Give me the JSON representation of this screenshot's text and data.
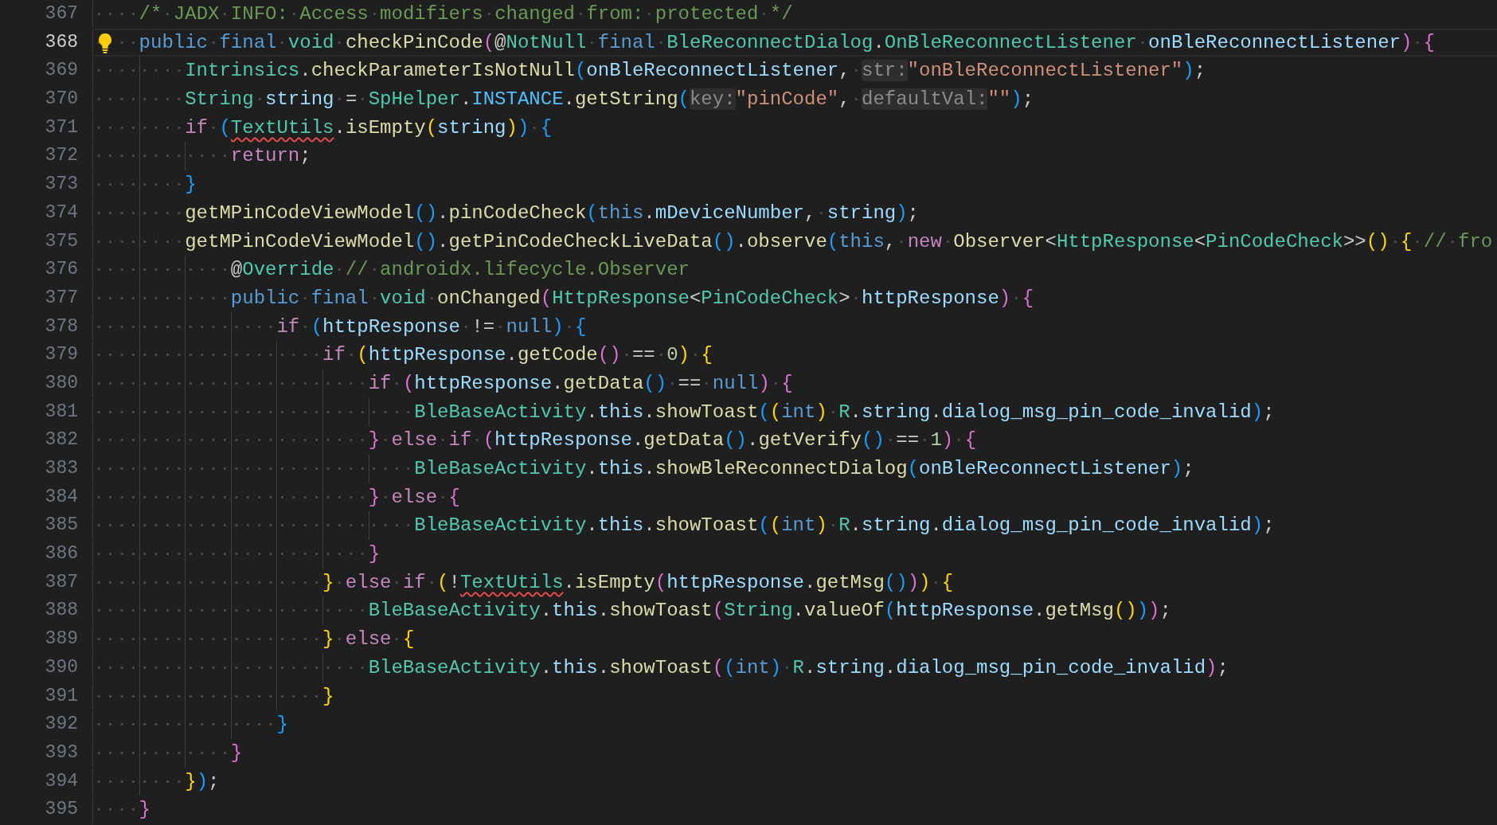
{
  "editor": {
    "lines": [
      {
        "number": "367",
        "current": false,
        "tokens": [
          {
            "kind": "cm",
            "text": "    /* JADX INFO: Access modifiers changed from: protected */"
          }
        ]
      },
      {
        "number": "368",
        "current": true,
        "tokens": [
          {
            "kind": "kw",
            "text": "    public final "
          },
          {
            "kind": "type",
            "text": "void "
          },
          {
            "kind": "fn",
            "text": "checkPinCode"
          },
          {
            "kind": "b2",
            "text": "("
          },
          {
            "kind": "p",
            "text": "@"
          },
          {
            "kind": "type",
            "text": "NotNull "
          },
          {
            "kind": "kw",
            "text": "final "
          },
          {
            "kind": "type",
            "text": "BleReconnectDialog"
          },
          {
            "kind": "p",
            "text": "."
          },
          {
            "kind": "type",
            "text": "OnBleReconnectListener "
          },
          {
            "kind": "var",
            "text": "onBleReconnectListener"
          },
          {
            "kind": "b2",
            "text": ") {"
          }
        ]
      },
      {
        "number": "369",
        "current": false,
        "tokens": [
          {
            "kind": "type",
            "text": "        Intrinsics"
          },
          {
            "kind": "p",
            "text": "."
          },
          {
            "kind": "fn",
            "text": "checkParameterIsNotNull"
          },
          {
            "kind": "b3",
            "text": "("
          },
          {
            "kind": "var",
            "text": "onBleReconnectListener"
          },
          {
            "kind": "p",
            "text": ", "
          },
          {
            "kind": "hint",
            "text": "str:"
          },
          {
            "kind": "str",
            "text": "\"onBleReconnectListener\""
          },
          {
            "kind": "b3",
            "text": ")"
          },
          {
            "kind": "p",
            "text": ";"
          }
        ]
      },
      {
        "number": "370",
        "current": false,
        "tokens": [
          {
            "kind": "type",
            "text": "        String "
          },
          {
            "kind": "var",
            "text": "string "
          },
          {
            "kind": "p",
            "text": "= "
          },
          {
            "kind": "type",
            "text": "SpHelper"
          },
          {
            "kind": "p",
            "text": "."
          },
          {
            "kind": "const",
            "text": "INSTANCE"
          },
          {
            "kind": "p",
            "text": "."
          },
          {
            "kind": "fn",
            "text": "getString"
          },
          {
            "kind": "b3",
            "text": "("
          },
          {
            "kind": "hint",
            "text": "key:"
          },
          {
            "kind": "str",
            "text": "\"pinCode\""
          },
          {
            "kind": "p",
            "text": ", "
          },
          {
            "kind": "hint",
            "text": "defaultVal:"
          },
          {
            "kind": "str",
            "text": "\"\""
          },
          {
            "kind": "b3",
            "text": ")"
          },
          {
            "kind": "p",
            "text": ";"
          }
        ]
      },
      {
        "number": "371",
        "current": false,
        "tokens": [
          {
            "kind": "ctl",
            "text": "        if "
          },
          {
            "kind": "b3",
            "text": "("
          },
          {
            "kind": "errtype",
            "text": "TextUtils"
          },
          {
            "kind": "p",
            "text": "."
          },
          {
            "kind": "fn",
            "text": "isEmpty"
          },
          {
            "kind": "b1",
            "text": "("
          },
          {
            "kind": "var",
            "text": "string"
          },
          {
            "kind": "b1",
            "text": ")"
          },
          {
            "kind": "b3",
            "text": ") {"
          }
        ]
      },
      {
        "number": "372",
        "current": false,
        "tokens": [
          {
            "kind": "ctl",
            "text": "            return"
          },
          {
            "kind": "p",
            "text": ";"
          }
        ]
      },
      {
        "number": "373",
        "current": false,
        "tokens": [
          {
            "kind": "b3",
            "text": "        }"
          }
        ]
      },
      {
        "number": "374",
        "current": false,
        "tokens": [
          {
            "kind": "fn",
            "text": "        getMPinCodeViewModel"
          },
          {
            "kind": "b3",
            "text": "()"
          },
          {
            "kind": "p",
            "text": "."
          },
          {
            "kind": "fn",
            "text": "pinCodeCheck"
          },
          {
            "kind": "b3",
            "text": "("
          },
          {
            "kind": "kw",
            "text": "this"
          },
          {
            "kind": "p",
            "text": "."
          },
          {
            "kind": "var",
            "text": "mDeviceNumber"
          },
          {
            "kind": "p",
            "text": ", "
          },
          {
            "kind": "var",
            "text": "string"
          },
          {
            "kind": "b3",
            "text": ")"
          },
          {
            "kind": "p",
            "text": ";"
          }
        ]
      },
      {
        "number": "375",
        "current": false,
        "tokens": [
          {
            "kind": "fn",
            "text": "        getMPinCodeViewModel"
          },
          {
            "kind": "b3",
            "text": "()"
          },
          {
            "kind": "p",
            "text": "."
          },
          {
            "kind": "fn",
            "text": "getPinCodeCheckLiveData"
          },
          {
            "kind": "b3",
            "text": "()"
          },
          {
            "kind": "p",
            "text": "."
          },
          {
            "kind": "fn",
            "text": "observe"
          },
          {
            "kind": "b3",
            "text": "("
          },
          {
            "kind": "kw",
            "text": "this"
          },
          {
            "kind": "p",
            "text": ", "
          },
          {
            "kind": "ctl",
            "text": "new "
          },
          {
            "kind": "fn",
            "text": "Observer"
          },
          {
            "kind": "p",
            "text": "<"
          },
          {
            "kind": "type",
            "text": "HttpResponse"
          },
          {
            "kind": "p",
            "text": "<"
          },
          {
            "kind": "type",
            "text": "PinCodeCheck"
          },
          {
            "kind": "p",
            "text": ">>"
          },
          {
            "kind": "b1",
            "text": "() { "
          },
          {
            "kind": "cm",
            "text": "// fro"
          }
        ]
      },
      {
        "number": "376",
        "current": false,
        "tokens": [
          {
            "kind": "p",
            "text": "            @"
          },
          {
            "kind": "type",
            "text": "Override "
          },
          {
            "kind": "cm",
            "text": "// androidx.lifecycle.Observer"
          }
        ]
      },
      {
        "number": "377",
        "current": false,
        "tokens": [
          {
            "kind": "kw",
            "text": "            public final "
          },
          {
            "kind": "type",
            "text": "void "
          },
          {
            "kind": "fn",
            "text": "onChanged"
          },
          {
            "kind": "b2",
            "text": "("
          },
          {
            "kind": "type",
            "text": "HttpResponse"
          },
          {
            "kind": "p",
            "text": "<"
          },
          {
            "kind": "type",
            "text": "PinCodeCheck"
          },
          {
            "kind": "p",
            "text": "> "
          },
          {
            "kind": "var",
            "text": "httpResponse"
          },
          {
            "kind": "b2",
            "text": ") {"
          }
        ]
      },
      {
        "number": "378",
        "current": false,
        "tokens": [
          {
            "kind": "ctl",
            "text": "                if "
          },
          {
            "kind": "b3",
            "text": "("
          },
          {
            "kind": "var",
            "text": "httpResponse "
          },
          {
            "kind": "p",
            "text": "!= "
          },
          {
            "kind": "kw",
            "text": "null"
          },
          {
            "kind": "b3",
            "text": ") {"
          }
        ]
      },
      {
        "number": "379",
        "current": false,
        "tokens": [
          {
            "kind": "ctl",
            "text": "                    if "
          },
          {
            "kind": "b1",
            "text": "("
          },
          {
            "kind": "var",
            "text": "httpResponse"
          },
          {
            "kind": "p",
            "text": "."
          },
          {
            "kind": "fn",
            "text": "getCode"
          },
          {
            "kind": "b2",
            "text": "()"
          },
          {
            "kind": "p",
            "text": " == "
          },
          {
            "kind": "num",
            "text": "0"
          },
          {
            "kind": "b1",
            "text": ") {"
          }
        ]
      },
      {
        "number": "380",
        "current": false,
        "tokens": [
          {
            "kind": "ctl",
            "text": "                        if "
          },
          {
            "kind": "b2",
            "text": "("
          },
          {
            "kind": "var",
            "text": "httpResponse"
          },
          {
            "kind": "p",
            "text": "."
          },
          {
            "kind": "fn",
            "text": "getData"
          },
          {
            "kind": "b3",
            "text": "()"
          },
          {
            "kind": "p",
            "text": " == "
          },
          {
            "kind": "kw",
            "text": "null"
          },
          {
            "kind": "b2",
            "text": ") {"
          }
        ]
      },
      {
        "number": "381",
        "current": false,
        "tokens": [
          {
            "kind": "type",
            "text": "                            BleBaseActivity"
          },
          {
            "kind": "p",
            "text": "."
          },
          {
            "kind": "var",
            "text": "this"
          },
          {
            "kind": "p",
            "text": "."
          },
          {
            "kind": "fn",
            "text": "showToast"
          },
          {
            "kind": "b3",
            "text": "("
          },
          {
            "kind": "b1",
            "text": "("
          },
          {
            "kind": "kw",
            "text": "int"
          },
          {
            "kind": "b1",
            "text": ") "
          },
          {
            "kind": "type",
            "text": "R"
          },
          {
            "kind": "p",
            "text": "."
          },
          {
            "kind": "var",
            "text": "string"
          },
          {
            "kind": "p",
            "text": "."
          },
          {
            "kind": "var",
            "text": "dialog_msg_pin_code_invalid"
          },
          {
            "kind": "b3",
            "text": ")"
          },
          {
            "kind": "p",
            "text": ";"
          }
        ]
      },
      {
        "number": "382",
        "current": false,
        "tokens": [
          {
            "kind": "b2",
            "text": "                        } "
          },
          {
            "kind": "ctl",
            "text": "else if "
          },
          {
            "kind": "b2",
            "text": "("
          },
          {
            "kind": "var",
            "text": "httpResponse"
          },
          {
            "kind": "p",
            "text": "."
          },
          {
            "kind": "fn",
            "text": "getData"
          },
          {
            "kind": "b3",
            "text": "()"
          },
          {
            "kind": "p",
            "text": "."
          },
          {
            "kind": "fn",
            "text": "getVerify"
          },
          {
            "kind": "b3",
            "text": "()"
          },
          {
            "kind": "p",
            "text": " == "
          },
          {
            "kind": "num",
            "text": "1"
          },
          {
            "kind": "b2",
            "text": ") {"
          }
        ]
      },
      {
        "number": "383",
        "current": false,
        "tokens": [
          {
            "kind": "type",
            "text": "                            BleBaseActivity"
          },
          {
            "kind": "p",
            "text": "."
          },
          {
            "kind": "var",
            "text": "this"
          },
          {
            "kind": "p",
            "text": "."
          },
          {
            "kind": "fn",
            "text": "showBleReconnectDialog"
          },
          {
            "kind": "b3",
            "text": "("
          },
          {
            "kind": "var",
            "text": "onBleReconnectListener"
          },
          {
            "kind": "b3",
            "text": ")"
          },
          {
            "kind": "p",
            "text": ";"
          }
        ]
      },
      {
        "number": "384",
        "current": false,
        "tokens": [
          {
            "kind": "b2",
            "text": "                        } "
          },
          {
            "kind": "ctl",
            "text": "else "
          },
          {
            "kind": "b2",
            "text": "{"
          }
        ]
      },
      {
        "number": "385",
        "current": false,
        "tokens": [
          {
            "kind": "type",
            "text": "                            BleBaseActivity"
          },
          {
            "kind": "p",
            "text": "."
          },
          {
            "kind": "var",
            "text": "this"
          },
          {
            "kind": "p",
            "text": "."
          },
          {
            "kind": "fn",
            "text": "showToast"
          },
          {
            "kind": "b3",
            "text": "("
          },
          {
            "kind": "b1",
            "text": "("
          },
          {
            "kind": "kw",
            "text": "int"
          },
          {
            "kind": "b1",
            "text": ") "
          },
          {
            "kind": "type",
            "text": "R"
          },
          {
            "kind": "p",
            "text": "."
          },
          {
            "kind": "var",
            "text": "string"
          },
          {
            "kind": "p",
            "text": "."
          },
          {
            "kind": "var",
            "text": "dialog_msg_pin_code_invalid"
          },
          {
            "kind": "b3",
            "text": ")"
          },
          {
            "kind": "p",
            "text": ";"
          }
        ]
      },
      {
        "number": "386",
        "current": false,
        "tokens": [
          {
            "kind": "b2",
            "text": "                        }"
          }
        ]
      },
      {
        "number": "387",
        "current": false,
        "tokens": [
          {
            "kind": "b1",
            "text": "                    } "
          },
          {
            "kind": "ctl",
            "text": "else if "
          },
          {
            "kind": "b1",
            "text": "("
          },
          {
            "kind": "p",
            "text": "!"
          },
          {
            "kind": "errtype",
            "text": "TextUtils"
          },
          {
            "kind": "p",
            "text": "."
          },
          {
            "kind": "fn",
            "text": "isEmpty"
          },
          {
            "kind": "b2",
            "text": "("
          },
          {
            "kind": "var",
            "text": "httpResponse"
          },
          {
            "kind": "p",
            "text": "."
          },
          {
            "kind": "fn",
            "text": "getMsg"
          },
          {
            "kind": "b3",
            "text": "()"
          },
          {
            "kind": "b2",
            "text": ")"
          },
          {
            "kind": "b1",
            "text": ") {"
          }
        ]
      },
      {
        "number": "388",
        "current": false,
        "tokens": [
          {
            "kind": "type",
            "text": "                        BleBaseActivity"
          },
          {
            "kind": "p",
            "text": "."
          },
          {
            "kind": "var",
            "text": "this"
          },
          {
            "kind": "p",
            "text": "."
          },
          {
            "kind": "fn",
            "text": "showToast"
          },
          {
            "kind": "b2",
            "text": "("
          },
          {
            "kind": "type",
            "text": "String"
          },
          {
            "kind": "p",
            "text": "."
          },
          {
            "kind": "fn",
            "text": "valueOf"
          },
          {
            "kind": "b3",
            "text": "("
          },
          {
            "kind": "var",
            "text": "httpResponse"
          },
          {
            "kind": "p",
            "text": "."
          },
          {
            "kind": "fn",
            "text": "getMsg"
          },
          {
            "kind": "b1",
            "text": "()"
          },
          {
            "kind": "b3",
            "text": ")"
          },
          {
            "kind": "b2",
            "text": ")"
          },
          {
            "kind": "p",
            "text": ";"
          }
        ]
      },
      {
        "number": "389",
        "current": false,
        "tokens": [
          {
            "kind": "b1",
            "text": "                    } "
          },
          {
            "kind": "ctl",
            "text": "else "
          },
          {
            "kind": "b1",
            "text": "{"
          }
        ]
      },
      {
        "number": "390",
        "current": false,
        "tokens": [
          {
            "kind": "type",
            "text": "                        BleBaseActivity"
          },
          {
            "kind": "p",
            "text": "."
          },
          {
            "kind": "var",
            "text": "this"
          },
          {
            "kind": "p",
            "text": "."
          },
          {
            "kind": "fn",
            "text": "showToast"
          },
          {
            "kind": "b2",
            "text": "("
          },
          {
            "kind": "b3",
            "text": "("
          },
          {
            "kind": "kw",
            "text": "int"
          },
          {
            "kind": "b3",
            "text": ") "
          },
          {
            "kind": "type",
            "text": "R"
          },
          {
            "kind": "p",
            "text": "."
          },
          {
            "kind": "var",
            "text": "string"
          },
          {
            "kind": "p",
            "text": "."
          },
          {
            "kind": "var",
            "text": "dialog_msg_pin_code_invalid"
          },
          {
            "kind": "b2",
            "text": ")"
          },
          {
            "kind": "p",
            "text": ";"
          }
        ]
      },
      {
        "number": "391",
        "current": false,
        "tokens": [
          {
            "kind": "b1",
            "text": "                    }"
          }
        ]
      },
      {
        "number": "392",
        "current": false,
        "tokens": [
          {
            "kind": "b3",
            "text": "                }"
          }
        ]
      },
      {
        "number": "393",
        "current": false,
        "tokens": [
          {
            "kind": "b2",
            "text": "            }"
          }
        ]
      },
      {
        "number": "394",
        "current": false,
        "tokens": [
          {
            "kind": "b1",
            "text": "        }"
          },
          {
            "kind": "b3",
            "text": ")"
          },
          {
            "kind": "p",
            "text": ";"
          }
        ]
      },
      {
        "number": "395",
        "current": false,
        "tokens": [
          {
            "kind": "b2",
            "text": "    }"
          }
        ]
      }
    ]
  }
}
